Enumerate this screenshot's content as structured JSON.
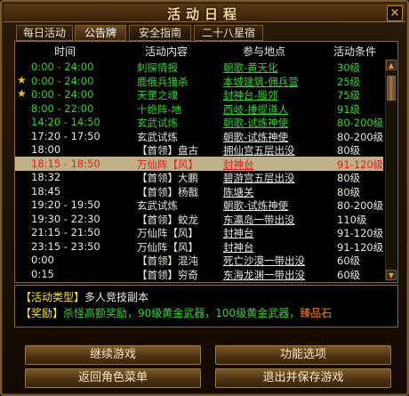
{
  "window": {
    "title": "活动日程",
    "close_label": "×"
  },
  "tabs": [
    {
      "label": "每日活动",
      "active": false
    },
    {
      "label": "公告牌",
      "active": true
    },
    {
      "label": "安全指南",
      "active": false
    },
    {
      "label": "二十八星宿",
      "active": false
    }
  ],
  "table": {
    "headers": [
      "时间",
      "活动内容",
      "参与地点",
      "活动条件"
    ],
    "rows": [
      {
        "star": false,
        "time": "0:00 - 24:00",
        "name": "刺探情报",
        "location": "朝歌-黄天化",
        "condition": "30级",
        "color": "#28d828"
      },
      {
        "star": true,
        "time": "0:00 - 24:00",
        "name": "鹿俄兵猎杀",
        "location": "本城建筑-佣兵营",
        "condition": "25级",
        "color": "#28d828"
      },
      {
        "star": true,
        "time": "0:00 - 24:00",
        "name": "天罡之魂",
        "location": "封神台-殷郊",
        "condition": "75级",
        "color": "#28d828"
      },
      {
        "star": false,
        "time": "8:00 - 22:00",
        "name": "十绝阵-地",
        "location": "西岐-捶提道人",
        "condition": "91级",
        "color": "#28d828"
      },
      {
        "star": false,
        "time": "14:20 - 14:50",
        "name": "玄武试炼",
        "location": "朝歌-试炼神使",
        "condition": "80-200级",
        "color": "#28d828"
      },
      {
        "star": false,
        "time": "17:20 - 17:50",
        "name": "玄武试炼",
        "location": "朝歌-试炼神使",
        "condition": "80-200级",
        "color": "#e8e8e0"
      },
      {
        "star": false,
        "time": "18:00",
        "name": "【首领】盘古",
        "location": "拥仙宫五层出没",
        "condition": "80级",
        "color": "#e8e8e0"
      },
      {
        "star": false,
        "time": "18:15 - 18:50",
        "name": "万仙阵【风】",
        "location": "封神台",
        "condition": "91-120级",
        "color": "#e02020",
        "selected": true
      },
      {
        "star": false,
        "time": "18:32",
        "name": "【首领】大鹏",
        "location": "碧游宫五层出没",
        "condition": "80级",
        "color": "#e8e8e0"
      },
      {
        "star": false,
        "time": "18:45",
        "name": "【首领】杨戬",
        "location": "陈塘关",
        "condition": "80级",
        "color": "#e8e8e0"
      },
      {
        "star": false,
        "time": "19:20 - 19:50",
        "name": "玄武试炼",
        "location": "朝歌-试炼神使",
        "condition": "80-200级",
        "color": "#e8e8e0"
      },
      {
        "star": false,
        "time": "19:30 - 22:30",
        "name": "【首领】蛟龙",
        "location": "东瀛岛一带出没",
        "condition": "110级",
        "color": "#e8e8e0"
      },
      {
        "star": false,
        "time": "21:15 - 21:50",
        "name": "万仙阵【风】",
        "location": "封神台",
        "condition": "91-120级",
        "color": "#e8e8e0"
      },
      {
        "star": false,
        "time": "23:15 - 23:50",
        "name": "万仙阵【风】",
        "location": "封神台",
        "condition": "91-120级",
        "color": "#e8e8e0"
      },
      {
        "star": false,
        "time": "0:00",
        "name": "【首领】混沌",
        "location": "死亡沙漠一带出没",
        "condition": "60级",
        "color": "#e8e8e0"
      },
      {
        "star": false,
        "time": "0:15",
        "name": "【首领】穷奇",
        "location": "东海龙渊一带出没",
        "condition": "60级",
        "color": "#e8e8e0"
      }
    ]
  },
  "scrollbar": {
    "up_label": "▲",
    "down_label": "▼",
    "position": 0.0
  },
  "info": {
    "type_label": "【活动类型】",
    "type_value": "多人竞技副本",
    "reward_label": "【奖励】",
    "reward_text": "杀怪高额奖励，90级黄金武器，100级黄金武器，",
    "reward_highlight": "臻品石"
  },
  "buttons": {
    "continue": "继续游戏",
    "options": "功能选项",
    "role_menu": "返回角色菜单",
    "save_exit": "退出并保存游戏"
  },
  "colors": {
    "green": "#28d828",
    "white": "#e8e8e0",
    "red": "#e02020",
    "yellow": "#f8e800",
    "orange": "#ff8a00",
    "gold_border": "#8a6a30",
    "selected_bg": "#c0b088"
  }
}
